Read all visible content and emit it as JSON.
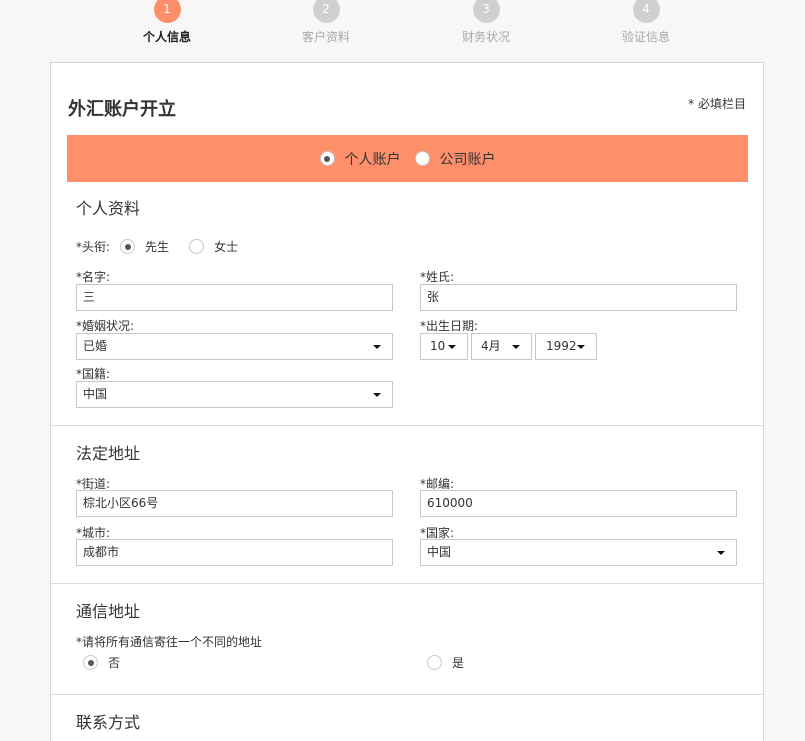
{
  "steps": [
    {
      "num": "1",
      "label": "个人信息"
    },
    {
      "num": "2",
      "label": "客户资料"
    },
    {
      "num": "3",
      "label": "财务状况"
    },
    {
      "num": "4",
      "label": "验证信息"
    }
  ],
  "form": {
    "title": "外汇账户开立",
    "required_note": "* 必填栏目",
    "account_type": {
      "options": [
        "个人账户",
        "公司账户"
      ],
      "selected": "个人账户"
    }
  },
  "personal": {
    "section_title": "个人资料",
    "title_label": "*头衔:",
    "title_options": [
      "先生",
      "女士"
    ],
    "title_selected": "先生",
    "first_name_label": "*名字:",
    "first_name_value": "三",
    "last_name_label": "*姓氏:",
    "last_name_value": "张",
    "marital_label": "*婚姻状况:",
    "marital_value": "已婚",
    "dob_label": "*出生日期:",
    "dob_day": "10",
    "dob_month": "4月",
    "dob_year": "1992",
    "nationality_label": "*国籍:",
    "nationality_value": "中国"
  },
  "legal_address": {
    "section_title": "法定地址",
    "street_label": "*街道:",
    "street_value": "棕北小区66号",
    "postcode_label": "*邮编:",
    "postcode_value": "610000",
    "city_label": "*城市:",
    "city_value": "成都市",
    "country_label": "*国家:",
    "country_value": "中国"
  },
  "mailing": {
    "section_title": "通信地址",
    "question": "*请将所有通信寄往一个不同的地址",
    "options": [
      "否",
      "是"
    ],
    "selected": "否"
  },
  "contact": {
    "section_title": "联系方式"
  }
}
